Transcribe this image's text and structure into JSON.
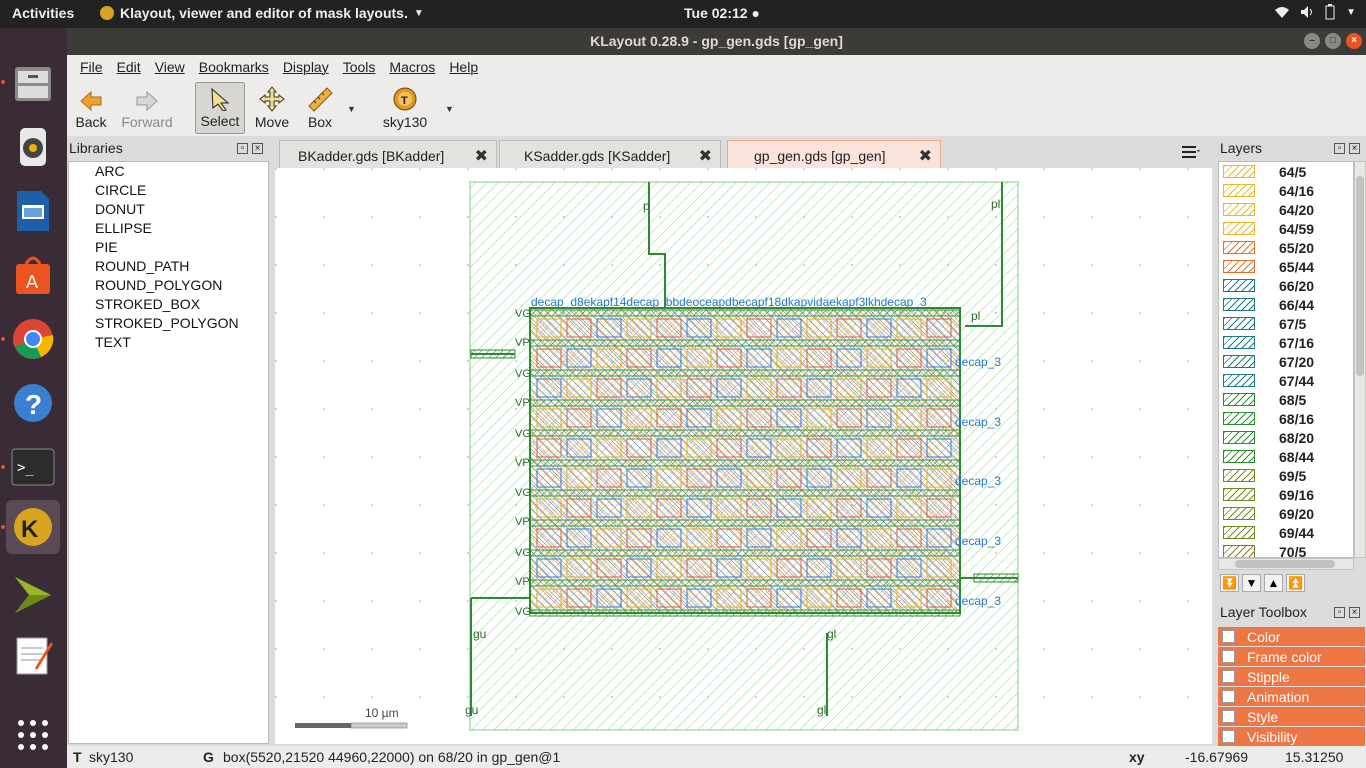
{
  "topbar": {
    "activities": "Activities",
    "app_name": "Klayout, viewer and editor of mask layouts.",
    "clock": "Tue 02:12"
  },
  "window": {
    "title": "KLayout 0.28.9 - gp_gen.gds [gp_gen]"
  },
  "menu": [
    "File",
    "Edit",
    "View",
    "Bookmarks",
    "Display",
    "Tools",
    "Macros",
    "Help"
  ],
  "toolbar": {
    "back": "Back",
    "forward": "Forward",
    "select": "Select",
    "move": "Move",
    "box": "Box",
    "tech": "sky130"
  },
  "libraries": {
    "title": "Libraries",
    "items": [
      "ARC",
      "CIRCLE",
      "DONUT",
      "ELLIPSE",
      "PIE",
      "ROUND_PATH",
      "ROUND_POLYGON",
      "STROKED_BOX",
      "STROKED_POLYGON",
      "TEXT"
    ]
  },
  "tabs": [
    {
      "label": "BKadder.gds [BKadder]"
    },
    {
      "label": "KSadder.gds [KSadder]"
    },
    {
      "label": "gp_gen.gds [gp_gen]"
    }
  ],
  "canvas": {
    "scale_label": "10 µm",
    "labels": {
      "p": "p",
      "pl": "pl",
      "gu": "gu",
      "gl": "gl",
      "decap": "decap_3",
      "vg": "VG",
      "vp": "VP"
    },
    "cell_text": "decap_d8ekapf14decap_bbdeoceapdbecapf18dkapvidaekapf3lkhdecap_3"
  },
  "layers": {
    "title": "Layers",
    "items": [
      {
        "name": "64/5",
        "color": "#e8b830"
      },
      {
        "name": "64/16",
        "color": "#e8b830"
      },
      {
        "name": "64/20",
        "color": "#e8b830"
      },
      {
        "name": "64/59",
        "color": "#e8b830"
      },
      {
        "name": "65/20",
        "color": "#e0742a"
      },
      {
        "name": "65/44",
        "color": "#e0742a"
      },
      {
        "name": "66/20",
        "color": "#1c7a86"
      },
      {
        "name": "66/44",
        "color": "#1c7a86"
      },
      {
        "name": "67/5",
        "color": "#1c7a86"
      },
      {
        "name": "67/16",
        "color": "#1c7a86"
      },
      {
        "name": "67/20",
        "color": "#1c7a86"
      },
      {
        "name": "67/44",
        "color": "#1c7a86"
      },
      {
        "name": "68/5",
        "color": "#2e8a2e"
      },
      {
        "name": "68/16",
        "color": "#2e8a2e"
      },
      {
        "name": "68/20",
        "color": "#2e8a2e"
      },
      {
        "name": "68/44",
        "color": "#2e8a2e"
      },
      {
        "name": "69/5",
        "color": "#6a8c1e"
      },
      {
        "name": "69/16",
        "color": "#6a8c1e"
      },
      {
        "name": "69/20",
        "color": "#6a8c1e"
      },
      {
        "name": "69/44",
        "color": "#6a8c1e"
      },
      {
        "name": "70/5",
        "color": "#8a7a1e"
      }
    ]
  },
  "toolbox": {
    "title": "Layer Toolbox",
    "items": [
      "Color",
      "Frame color",
      "Stipple",
      "Animation",
      "Style",
      "Visibility"
    ]
  },
  "status": {
    "mode": "T",
    "tech": "sky130",
    "g": "G",
    "message": "box(5520,21520 44960,22000) on 68/20 in gp_gen@1",
    "xy_label": "xy",
    "x": "-16.67969",
    "y": "15.31250"
  }
}
